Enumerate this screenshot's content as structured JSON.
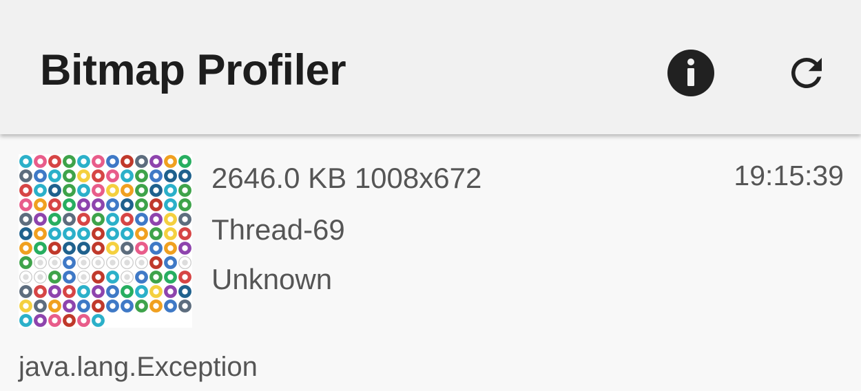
{
  "appbar": {
    "title": "Bitmap Profiler",
    "actions": [
      {
        "icon": "info-icon",
        "color": "#212121"
      },
      {
        "icon": "refresh-icon",
        "color": "#212121"
      }
    ]
  },
  "bitmaps": [
    {
      "thumbnail": "icon-sprite-sheet",
      "size_label": "2646.0 KB 1008x672",
      "thread": "Thread-69",
      "origin": "Unknown",
      "time": "19:15:39",
      "stack_first_line": "java.lang.Exception"
    }
  ],
  "thumbnail_palette": [
    "#3f79c6",
    "#d64545",
    "#3ea34a",
    "#f0a020",
    "#8e44ad",
    "#2bb0c9",
    "#e85c8a",
    "#5d6d7e",
    "#f4d03f",
    "#27ae60",
    "#c0392b",
    "#1f618d"
  ]
}
